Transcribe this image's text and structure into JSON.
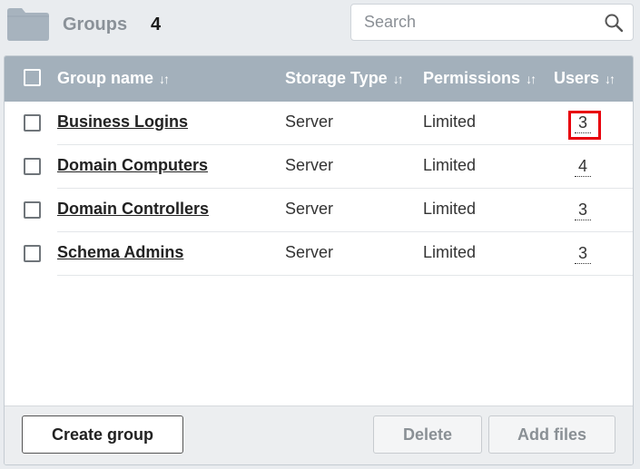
{
  "header": {
    "title": "Groups",
    "count": "4",
    "folder_icon": "folder-icon"
  },
  "search": {
    "placeholder": "Search",
    "value": "",
    "icon": "search-icon"
  },
  "table": {
    "columns": [
      {
        "label": "Group name",
        "sort_icon": "sort-icon"
      },
      {
        "label": "Storage Type",
        "sort_icon": "sort-icon"
      },
      {
        "label": "Permissions",
        "sort_icon": "sort-icon"
      },
      {
        "label": "Users",
        "sort_icon": "sort-icon"
      }
    ],
    "sort_glyph": "↓↑",
    "rows": [
      {
        "name": "Business Logins",
        "storage": "Server",
        "permissions": "Limited",
        "users": "3"
      },
      {
        "name": "Domain Computers",
        "storage": "Server",
        "permissions": "Limited",
        "users": "4"
      },
      {
        "name": "Domain Controllers",
        "storage": "Server",
        "permissions": "Limited",
        "users": "3"
      },
      {
        "name": "Schema Admins",
        "storage": "Server",
        "permissions": "Limited",
        "users": "3"
      }
    ]
  },
  "footer": {
    "create_label": "Create group",
    "delete_label": "Delete",
    "add_files_label": "Add files"
  },
  "colors": {
    "header_bg": "#a3b0bb",
    "highlight": "#e8000b",
    "page_bg": "#e9ecef"
  }
}
